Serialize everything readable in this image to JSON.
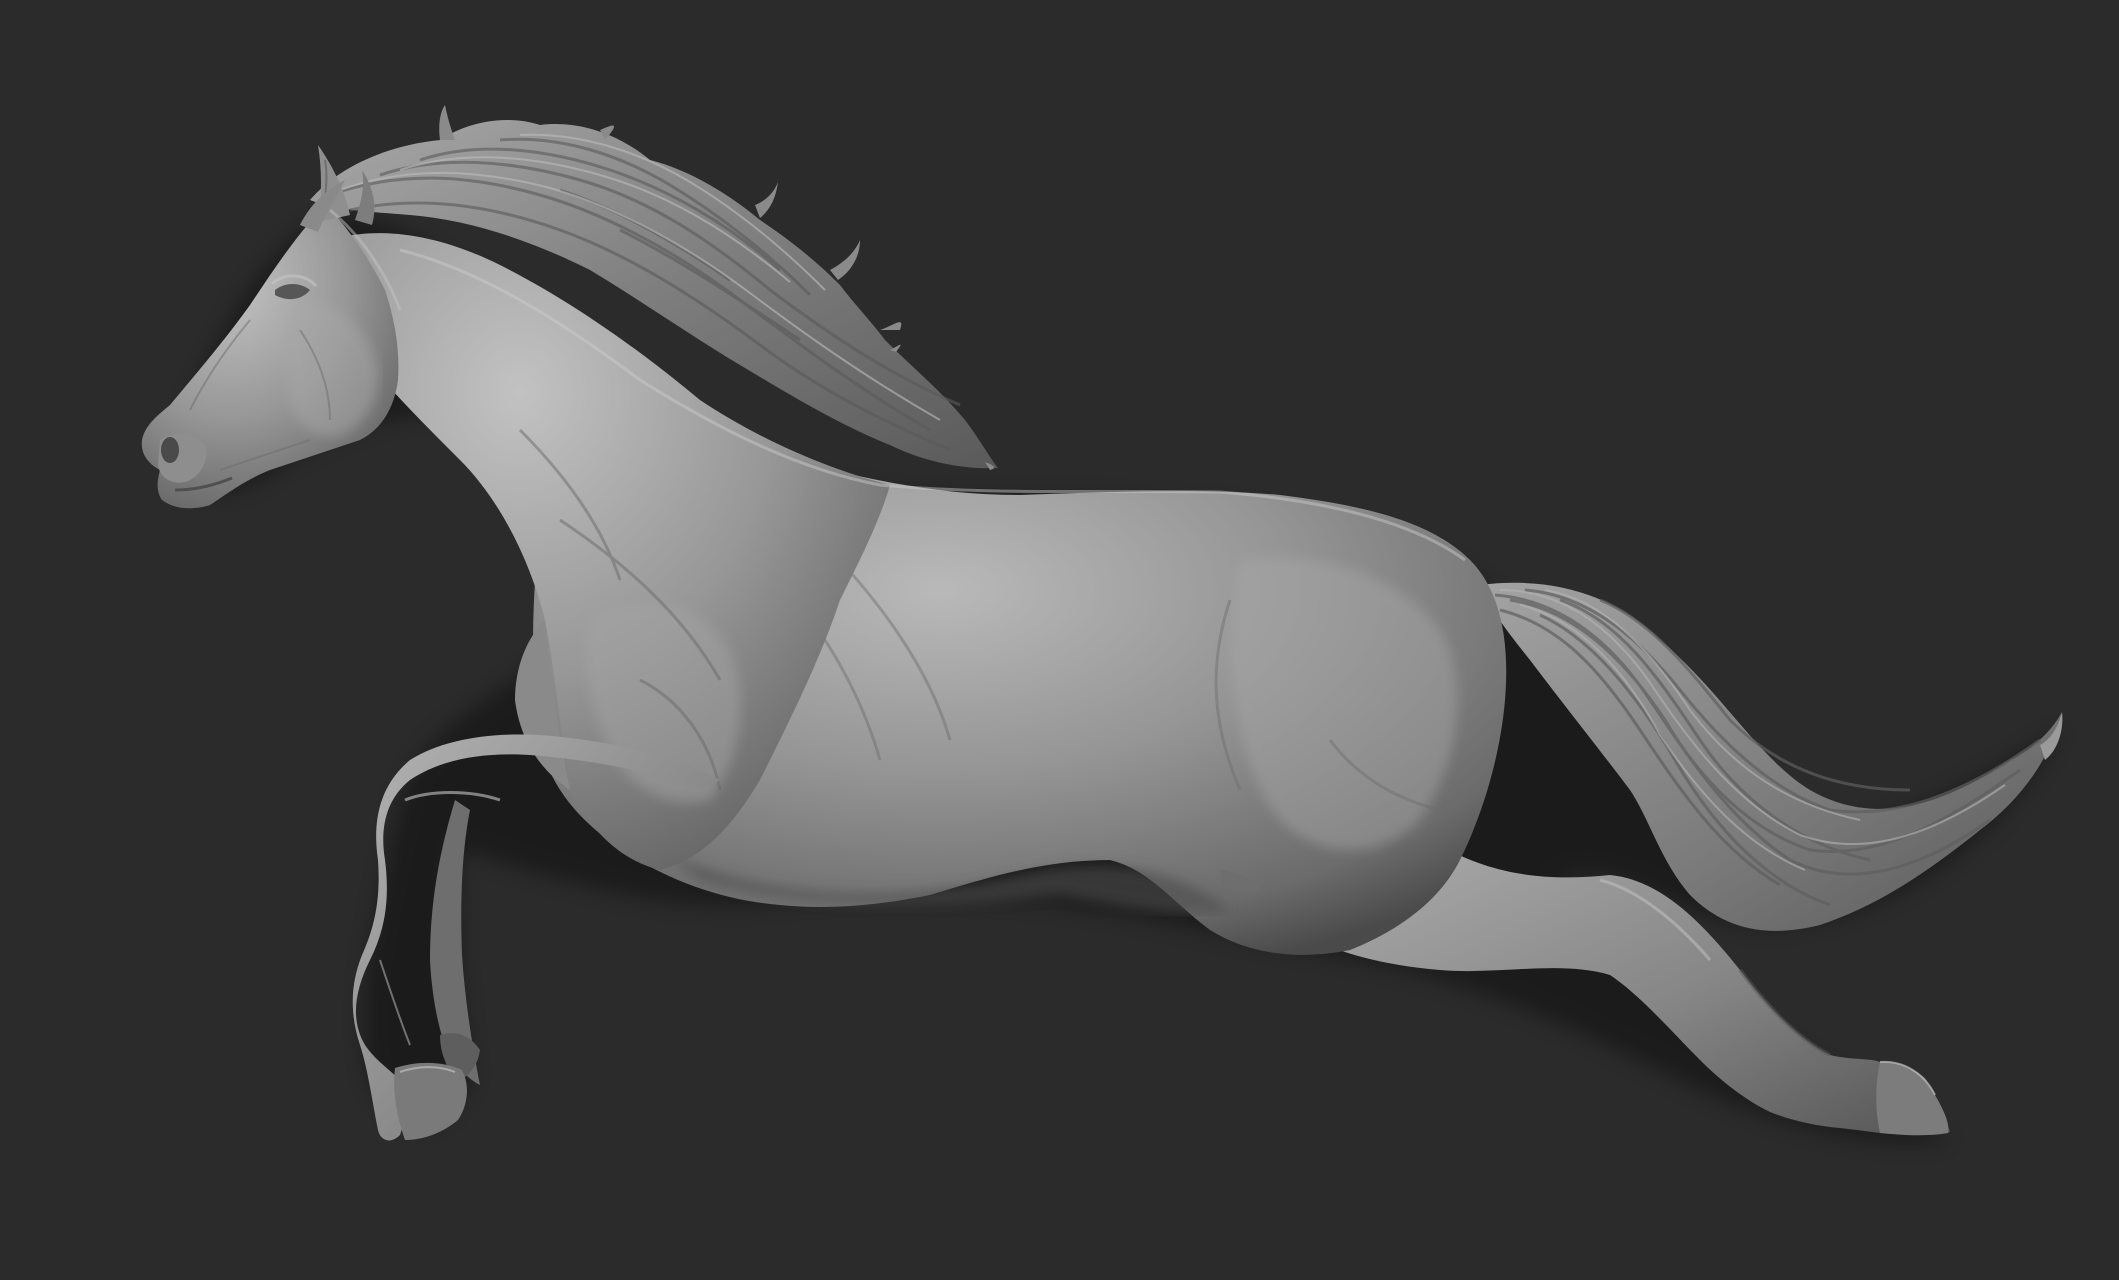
{
  "scene": {
    "subject": "horse-relief-sculpt",
    "background_color": "#2b2b2c",
    "material_color": "#8f8f8f",
    "highlight_color": "#c4c4c4",
    "shadow_color": "#3f3f3f"
  }
}
